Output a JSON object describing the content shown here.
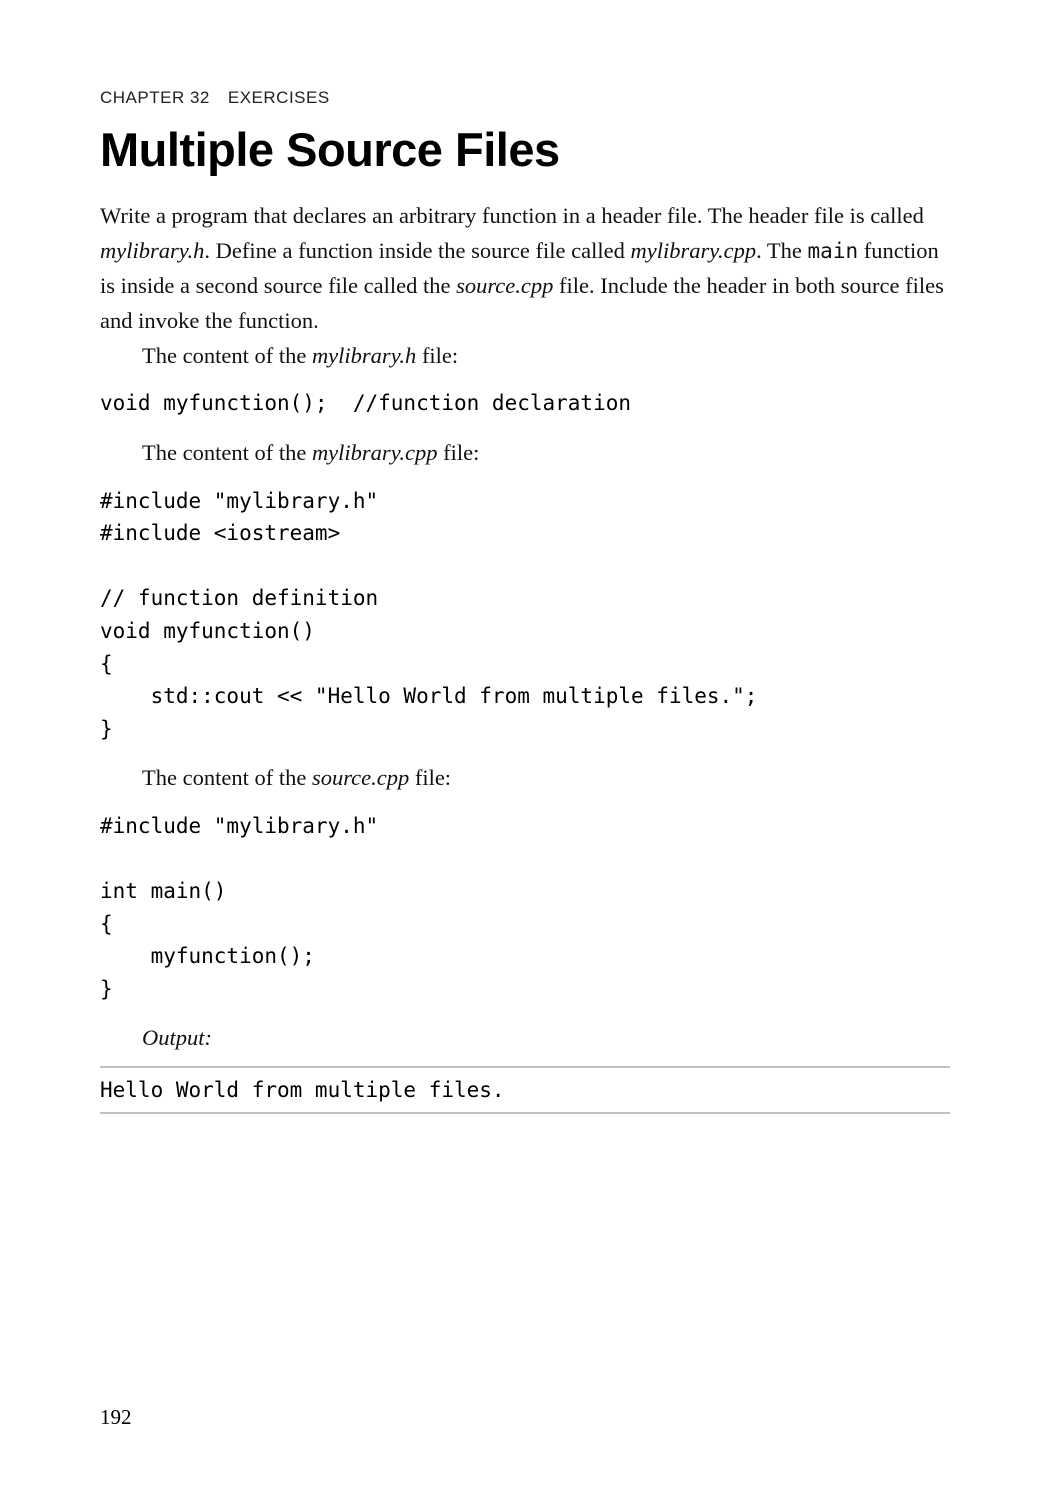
{
  "header": {
    "chapter": "CHAPTER 32",
    "subject": "EXERCISES"
  },
  "title": "Multiple Source Files",
  "para1_a": "Write a program that declares an arbitrary function in a header file. The header file is called ",
  "para1_b": "mylibrary.h",
  "para1_c": ". Define a function inside the source file called ",
  "para1_d": "mylibrary.cpp",
  "para1_e": ". The ",
  "para1_f": "main",
  "para1_g": " function is inside a second source file called the ",
  "para1_h": "source.cpp",
  "para1_i": " file. Include the header in both source files and invoke the function.",
  "para2_a": "The content of the ",
  "para2_b": "mylibrary.h",
  "para2_c": " file:",
  "code1": "void myfunction();  //function declaration",
  "para3_a": "The content of the ",
  "para3_b": "mylibrary.cpp",
  "para3_c": " file:",
  "code2": "#include \"mylibrary.h\"\n#include <iostream>\n\n// function definition\nvoid myfunction()\n{\n    std::cout << \"Hello World from multiple files.\";\n}",
  "para4_a": "The content of the ",
  "para4_b": "source.cpp",
  "para4_c": " file:",
  "code3": "#include \"mylibrary.h\"\n\nint main()\n{\n    myfunction();\n}",
  "output_label": "Output:",
  "output_text": "Hello World from multiple files.",
  "page_number": "192"
}
